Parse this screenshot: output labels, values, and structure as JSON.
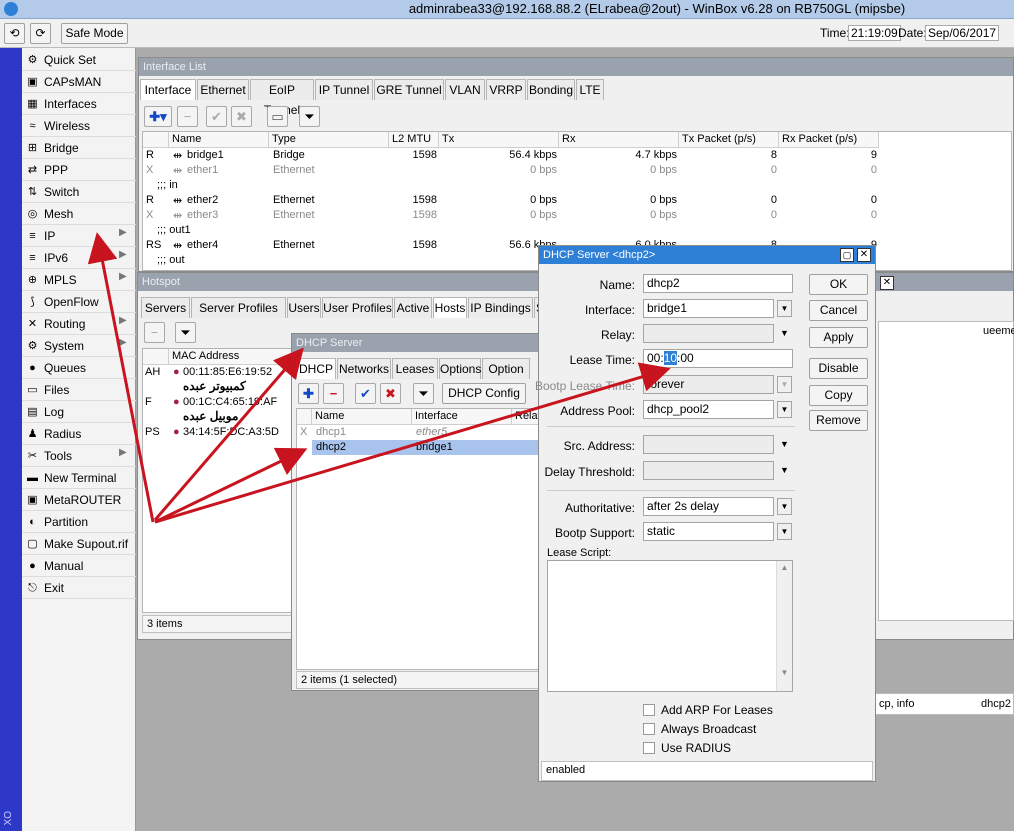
{
  "titlebar": {
    "title": "adminrabea33@192.168.88.2 (ELrabea@2out) - WinBox v6.28 on RB750GL (mipsbe)"
  },
  "toolbar": {
    "undo": "⟲",
    "redo": "⟳",
    "safe_mode": "Safe Mode",
    "time_label": "Time:",
    "time": "21:19:09",
    "date_label": "Date:",
    "date": "Sep/06/2017"
  },
  "vertical_label": "XO",
  "sidebar": {
    "items": [
      {
        "icon": "⚙",
        "label": "Quick Set",
        "sub": false
      },
      {
        "icon": "▣",
        "label": "CAPsMAN",
        "sub": false
      },
      {
        "icon": "▦",
        "label": "Interfaces",
        "sub": false
      },
      {
        "icon": "≈",
        "label": "Wireless",
        "sub": false
      },
      {
        "icon": "⊞",
        "label": "Bridge",
        "sub": false
      },
      {
        "icon": "⇄",
        "label": "PPP",
        "sub": false
      },
      {
        "icon": "⇅",
        "label": "Switch",
        "sub": false
      },
      {
        "icon": "◎",
        "label": "Mesh",
        "sub": false
      },
      {
        "icon": "≡",
        "label": "IP",
        "sub": true
      },
      {
        "icon": "≡",
        "label": "IPv6",
        "sub": true
      },
      {
        "icon": "⊕",
        "label": "MPLS",
        "sub": true
      },
      {
        "icon": "⟆",
        "label": "OpenFlow",
        "sub": false
      },
      {
        "icon": "✕",
        "label": "Routing",
        "sub": true
      },
      {
        "icon": "⚙",
        "label": "System",
        "sub": true
      },
      {
        "icon": "●",
        "label": "Queues",
        "sub": false
      },
      {
        "icon": "▭",
        "label": "Files",
        "sub": false
      },
      {
        "icon": "▤",
        "label": "Log",
        "sub": false
      },
      {
        "icon": "♟",
        "label": "Radius",
        "sub": false
      },
      {
        "icon": "✂",
        "label": "Tools",
        "sub": true
      },
      {
        "icon": "▬",
        "label": "New Terminal",
        "sub": false
      },
      {
        "icon": "▣",
        "label": "MetaROUTER",
        "sub": false
      },
      {
        "icon": "◐",
        "label": "Partition",
        "sub": false
      },
      {
        "icon": "▢",
        "label": "Make Supout.rif",
        "sub": false
      },
      {
        "icon": "●",
        "label": "Manual",
        "sub": false
      },
      {
        "icon": "⎋",
        "label": "Exit",
        "sub": false
      }
    ]
  },
  "interface_list": {
    "title": "Interface List",
    "tabs": [
      "Interface",
      "Ethernet",
      "EoIP Tunnel",
      "IP Tunnel",
      "GRE Tunnel",
      "VLAN",
      "VRRP",
      "Bonding",
      "LTE"
    ],
    "columns": [
      "Name",
      "Type",
      "L2 MTU",
      "Tx",
      "Rx",
      "Tx Packet (p/s)",
      "Rx Packet (p/s)"
    ],
    "rows": [
      {
        "kind": "row",
        "flag": "R",
        "name": "bridge1",
        "type": "Bridge",
        "mtu": "1598",
        "tx": "56.4 kbps",
        "rx": "4.7 kbps",
        "txp": "8",
        "rxp": "9",
        "dim": false
      },
      {
        "kind": "row",
        "flag": "X",
        "name": "ether1",
        "type": "Ethernet",
        "mtu": "",
        "tx": "0 bps",
        "rx": "0 bps",
        "txp": "0",
        "rxp": "0",
        "dim": true
      },
      {
        "kind": "comment",
        "text": ";;; in"
      },
      {
        "kind": "row",
        "flag": "R",
        "name": "ether2",
        "type": "Ethernet",
        "mtu": "1598",
        "tx": "0 bps",
        "rx": "0 bps",
        "txp": "0",
        "rxp": "0",
        "dim": false
      },
      {
        "kind": "row",
        "flag": "X",
        "name": "ether3",
        "type": "Ethernet",
        "mtu": "1598",
        "tx": "0 bps",
        "rx": "0 bps",
        "txp": "0",
        "rxp": "0",
        "dim": true
      },
      {
        "kind": "comment",
        "text": ";;; out1"
      },
      {
        "kind": "row",
        "flag": "RS",
        "name": "ether4",
        "type": "Ethernet",
        "mtu": "1598",
        "tx": "56.6 kbps",
        "rx": "6.0 kbps",
        "txp": "8",
        "rxp": "9",
        "dim": false
      },
      {
        "kind": "comment",
        "text": ";;; out"
      }
    ]
  },
  "hotspot": {
    "title": "Hotspot",
    "tabs": [
      "Servers",
      "Server Profiles",
      "Users",
      "User Profiles",
      "Active",
      "Hosts",
      "IP Bindings",
      "S"
    ],
    "col_mac": "MAC Address",
    "rows": [
      {
        "flag": "AH",
        "mac": "00:11:85:E6:19:52",
        "comment": ""
      },
      {
        "flag": "",
        "mac": "",
        "comment": "كمبيوتر عبده"
      },
      {
        "flag": "F",
        "mac": "00:1C:C4:65:19:AF",
        "comment": ""
      },
      {
        "flag": "",
        "mac": "",
        "comment": "موبيل عبده"
      },
      {
        "flag": "PS",
        "mac": "34:14:5F:DC:A3:5D",
        "comment": ""
      }
    ],
    "status": "3 items",
    "right_frag1": "ueeme",
    "right_frag2": "cp, info",
    "right_frag3": "dhcp2"
  },
  "dhcp_server": {
    "title": "DHCP Server",
    "tabs": [
      "DHCP",
      "Networks",
      "Leases",
      "Options",
      "Option Se"
    ],
    "config_btn": "DHCP Config",
    "columns": [
      "Name",
      "Interface",
      "Relay"
    ],
    "rows": [
      {
        "flag": "X",
        "name": "dhcp1",
        "iface": "ether5",
        "selected": false
      },
      {
        "flag": "",
        "name": "dhcp2",
        "iface": "bridge1",
        "selected": true
      }
    ],
    "status": "2 items (1 selected)"
  },
  "dhcp_dialog": {
    "title": "DHCP Server <dhcp2>",
    "fields": {
      "name_label": "Name:",
      "name": "dhcp2",
      "interface_label": "Interface:",
      "interface": "bridge1",
      "relay_label": "Relay:",
      "relay": "",
      "lease_label": "Lease Time:",
      "lease_a": "00:",
      "lease_b": "10",
      "lease_c": ":00",
      "bootp_lease_label": "Bootp Lease Time:",
      "bootp_lease": "forever",
      "pool_label": "Address Pool:",
      "pool": "dhcp_pool2",
      "src_label": "Src. Address:",
      "src": "",
      "delay_label": "Delay Threshold:",
      "delay": "",
      "auth_label": "Authoritative:",
      "auth": "after 2s delay",
      "bootp_label": "Bootp Support:",
      "bootp": "static",
      "script_label": "Lease Script:"
    },
    "checks": [
      "Add ARP For Leases",
      "Always Broadcast",
      "Use RADIUS"
    ],
    "buttons": [
      "OK",
      "Cancel",
      "Apply",
      "Disable",
      "Copy",
      "Remove"
    ],
    "status": "enabled"
  },
  "colors": {
    "arrow": "#c8141e",
    "accent": "#2e7fd6",
    "selection": "#a9c4ec"
  }
}
